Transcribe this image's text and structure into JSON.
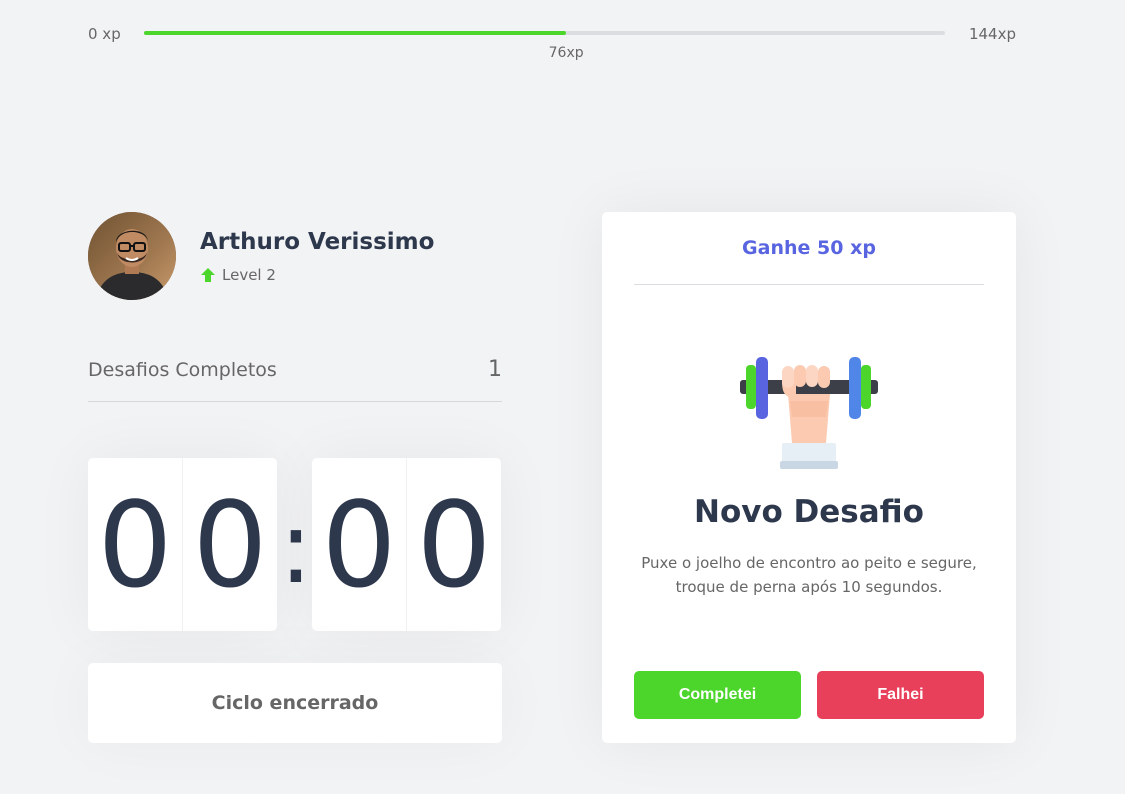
{
  "xp": {
    "min_label": "0 xp",
    "max_label": "144xp",
    "current_label": "76xp",
    "progress": 0.527
  },
  "profile": {
    "name": "Arthuro Verissimo",
    "level": "Level 2"
  },
  "challenges": {
    "label": "Desafios Completos",
    "value": "1"
  },
  "countdown": {
    "minute_left": "0",
    "minute_right": "0",
    "separator": ":",
    "second_left": "0",
    "second_right": "0"
  },
  "cycle_button": {
    "label": "Ciclo encerrado"
  },
  "challenge_card": {
    "reward": "Ganhe 50 xp",
    "title": "Novo Desafio",
    "description": "Puxe o joelho de encontro ao peito e segure, troque de perna após 10 segundos.",
    "success_label": "Completei",
    "fail_label": "Falhei",
    "icon": "dumbbell-hand-icon"
  },
  "colors": {
    "background": "#f2f3f5",
    "green": "#4cd62b",
    "red": "#e83f5b",
    "blue": "#5965e0",
    "title": "#2e384d",
    "text": "#666666"
  }
}
